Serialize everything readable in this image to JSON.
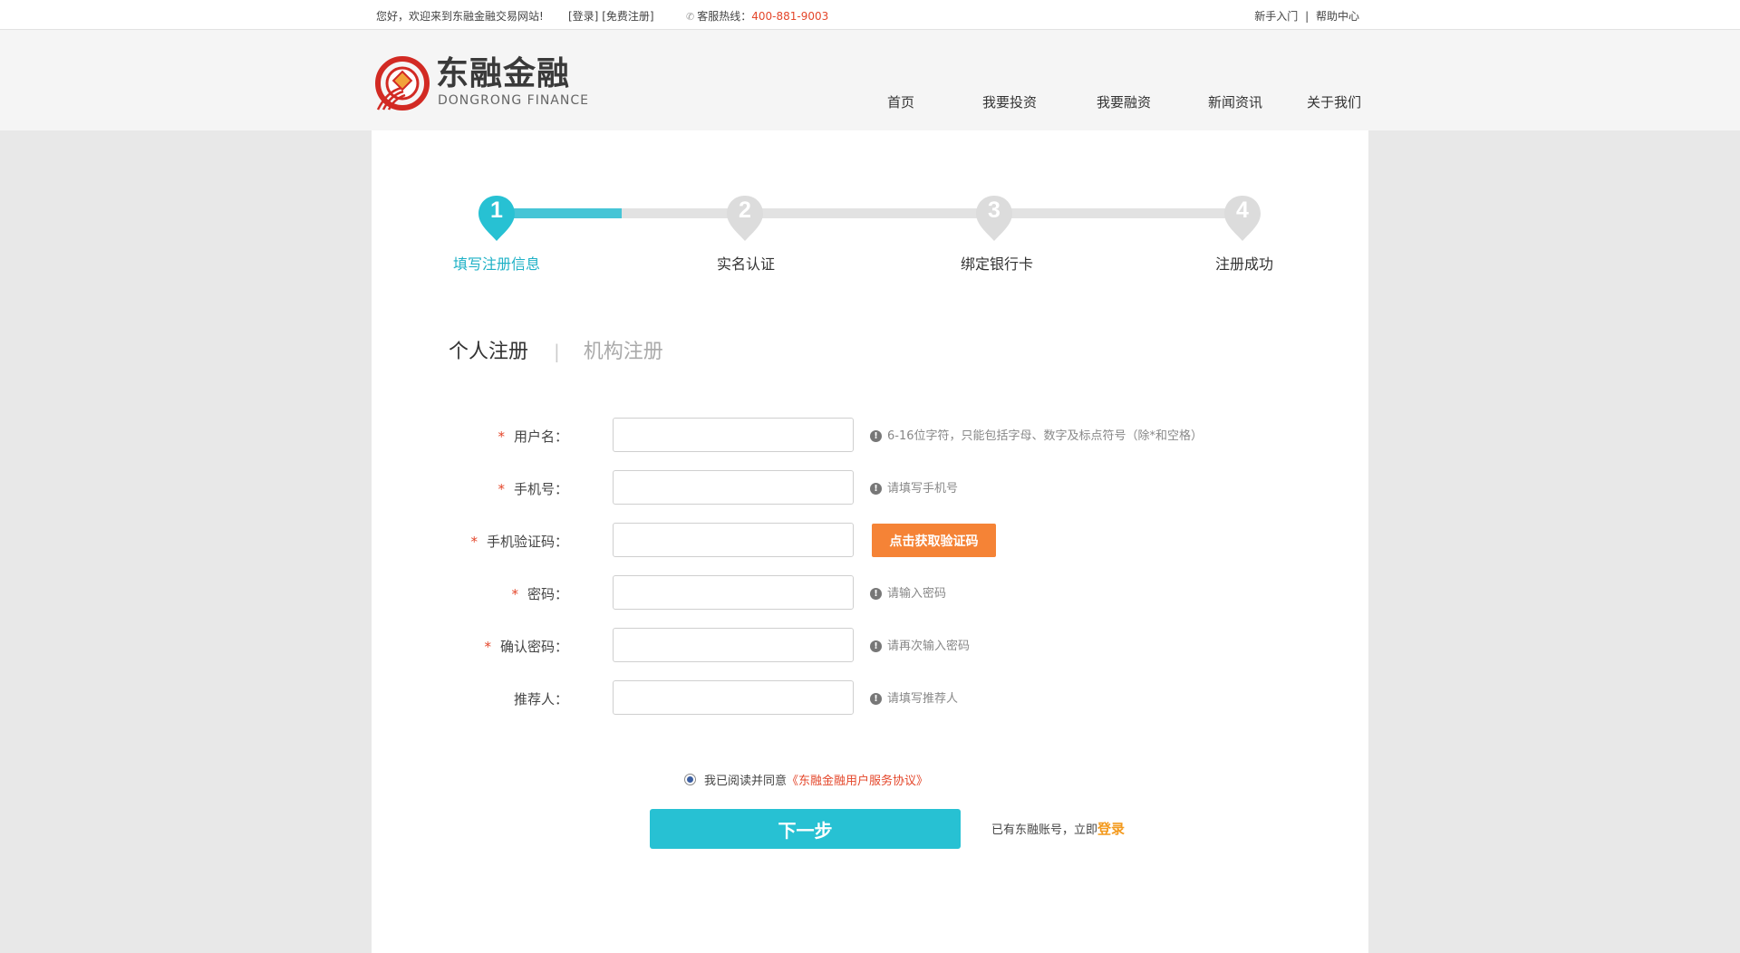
{
  "topbar": {
    "welcome": "您好，欢迎来到东融金融交易网站!",
    "login_link": "[登录]",
    "register_link": "[免费注册]",
    "hotline_label": "客服热线：",
    "hotline_number": "400-881-9003",
    "beginner": "新手入门",
    "separator": "|",
    "help": "帮助中心"
  },
  "header": {
    "logo_cn": "东融金融",
    "logo_en": "DONGRONG FINANCE",
    "nav": [
      "首页",
      "我要投资",
      "我要融资",
      "新闻资讯",
      "关于我们"
    ]
  },
  "steps": [
    {
      "num": "1",
      "label": "填写注册信息",
      "active": true
    },
    {
      "num": "2",
      "label": "实名认证",
      "active": false
    },
    {
      "num": "3",
      "label": "绑定银行卡",
      "active": false
    },
    {
      "num": "4",
      "label": "注册成功",
      "active": false
    }
  ],
  "tabs": {
    "personal": "个人注册",
    "separator": "|",
    "institution": "机构注册"
  },
  "form": {
    "username": {
      "label": "用户名：",
      "required": "*",
      "hint": "6-16位字符，只能包括字母、数字及标点符号（除*和空格）",
      "value": ""
    },
    "phone": {
      "label": "手机号：",
      "required": "*",
      "hint": "请填写手机号",
      "value": ""
    },
    "sms_code": {
      "label": "手机验证码：",
      "required": "*",
      "button": "点击获取验证码",
      "value": ""
    },
    "password": {
      "label": "密码：",
      "required": "*",
      "hint": "请输入密码",
      "value": ""
    },
    "confirm_password": {
      "label": "确认密码：",
      "required": "*",
      "hint": "请再次输入密码",
      "value": ""
    },
    "referrer": {
      "label": "推荐人：",
      "hint": "请填写推荐人",
      "value": ""
    }
  },
  "agreement": {
    "prefix": "我已阅读并同意",
    "link": "《东融金融用户服务协议》",
    "checked": true
  },
  "next_button": "下一步",
  "have_account": {
    "prefix": "已有东融账号，立即",
    "login": "登录"
  },
  "colors": {
    "accent": "#27c1d3",
    "orange": "#f58336",
    "red": "#e4462a",
    "gold": "#f39a1e"
  }
}
